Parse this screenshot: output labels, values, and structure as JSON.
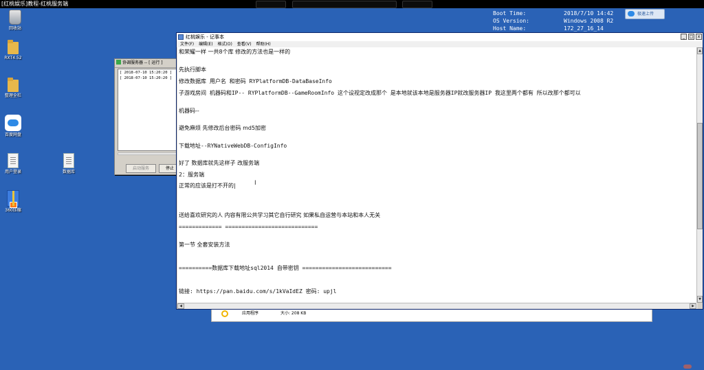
{
  "video_bar": {
    "title": "[红桃娱乐]教程-红桃服务端"
  },
  "sysinfo": {
    "keys": [
      "Boot Time:",
      "OS Version:",
      "Host Name:"
    ],
    "values": [
      "2018/7/10 14:42",
      "Windows 2008 R2",
      "172_27_16_14"
    ]
  },
  "upload_button": {
    "label": "极速上传"
  },
  "desktop_icons": [
    {
      "label": "回收站",
      "icon": "recycle-bin-icon"
    },
    {
      "label": "RXT4.52",
      "icon": "folder-icon"
    },
    {
      "label": "整理全栏",
      "icon": "folder-icon"
    },
    {
      "label": "百度网盘",
      "icon": "baidu-netdisk-icon"
    },
    {
      "label": "用户登录",
      "icon": "document-icon"
    },
    {
      "label": "数据库",
      "icon": "document-icon"
    },
    {
      "label": "360压缩",
      "icon": "zip-icon"
    }
  ],
  "sync_window": {
    "title": "协调服务器 -- [ 运行 ]",
    "log": [
      "[ 2018-07-10 15:20:20 ]",
      "[ 2018-07-10 15:20:20 ]"
    ],
    "start_button": "启动服务",
    "stop_button": "停止"
  },
  "behind_window": {
    "type_label": "应用程序",
    "size_label": "大小: 208 KB"
  },
  "notepad": {
    "title": "红桃娱乐 - 记事本",
    "window_buttons": [
      "_",
      "□",
      "x"
    ],
    "menu": [
      "文件(F)",
      "编辑(E)",
      "格式(O)",
      "查看(V)",
      "帮助(H)"
    ],
    "lines": [
      "和荣耀一样  一共8个库  修改的方法也是一样的",
      "先执行脚本",
      "修改数据库 用户名 和密码  RYPlatformDB-DataBaseInfo",
      "子游戏房间  机器码和IP-- RYPlatformDB--GameRoomInfo                这个设视定改成那个  是本地就该本地是服务器IP就改服务器IP     我这里两个都有  所以改那个都可以",
      "机器码--",
      "避免麻烦   先修改后台密码  md5加密",
      "下载地址--RYNativeWebDB-ConfigInfo",
      " 好了  数据库就先这样子      改服务端",
      "2：服务端",
      "正常的应该是打不开的|",
      "送给喜欢研究的人      内容有限公共学习其它自行研究  如果私自运营与本站和本人无关",
      "============= ============================",
      "第一节 全套安装方法",
      "==========数据库下载地址sql2014 自带密钥    ===========================",
      "链接: https://pan.baidu.com/s/1kVaIdEZ 密码: upjl"
    ]
  }
}
